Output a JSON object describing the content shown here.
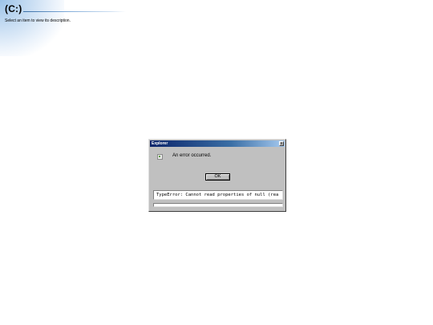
{
  "folder": {
    "title": "(C:)",
    "description": "Select an item to view its description."
  },
  "dialog": {
    "title": "Explorer",
    "close_label": "x",
    "message": "An error occurred.",
    "ok_label": "OK",
    "error_detail": "TypeError: Cannot read properties of null (rea",
    "icon": "broken-image-icon"
  },
  "colors": {
    "titlebar_start": "#0a246a",
    "titlebar_end": "#a6caf0",
    "dialog_face": "#c0c0c0",
    "header_accent": "#3a6ea5"
  }
}
